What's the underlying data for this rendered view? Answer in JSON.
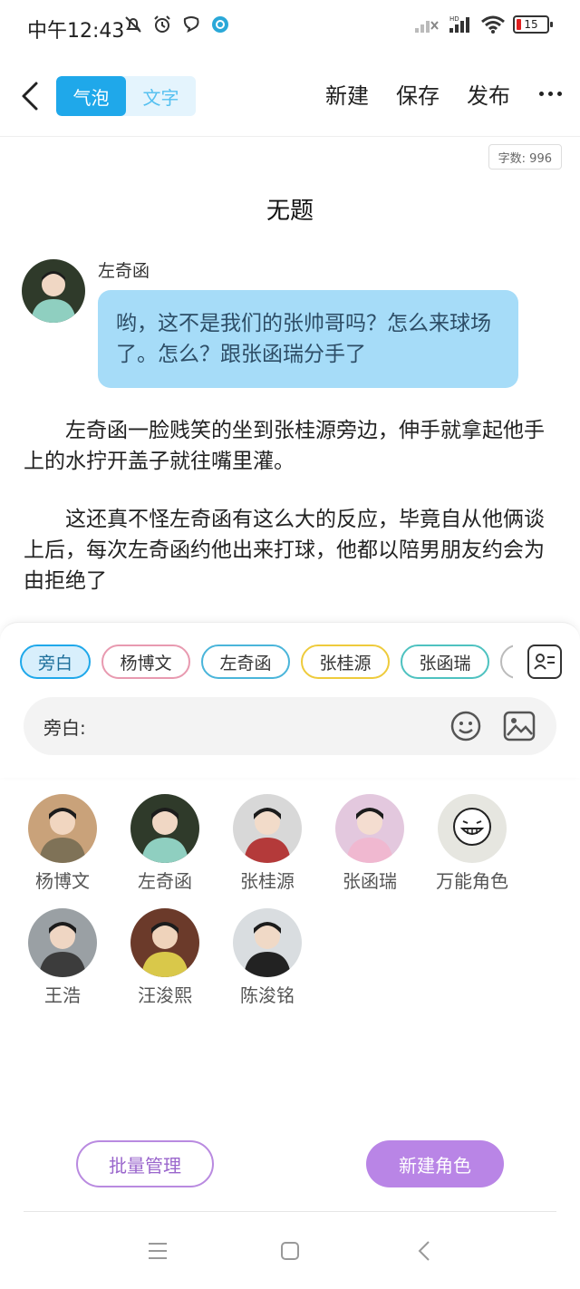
{
  "status_bar": {
    "time": "中午12:43",
    "battery": "15"
  },
  "top_bar": {
    "tab_bubble": "气泡",
    "tab_text": "文字",
    "new": "新建",
    "save": "保存",
    "publish": "发布"
  },
  "word_count": "字数: 996",
  "title": "无题",
  "dialogue": {
    "speaker": "左奇函",
    "text": "哟，这不是我们的张帅哥吗？怎么来球场了。怎么？跟张函瑞分手了"
  },
  "narrations": [
    "左奇函一脸贱笑的坐到张桂源旁边，伸手就拿起他手上的水拧开盖子就往嘴里灌。",
    "这还真不怪左奇函有这么大的反应，毕竟自从他俩谈上后，每次左奇函约他出来打球，他都以陪男朋友约会为由拒绝了"
  ],
  "chips": [
    "旁白",
    "杨博文",
    "左奇函",
    "张桂源",
    "张函瑞"
  ],
  "input": {
    "label": "旁白:"
  },
  "characters": [
    {
      "name": "杨博文",
      "bg": "#c9a27a",
      "skin": "#f1d6c0",
      "shirt": "#7f7257"
    },
    {
      "name": "左奇函",
      "bg": "#2f3a2a",
      "skin": "#f0d7c4",
      "shirt": "#8fcfc0"
    },
    {
      "name": "张桂源",
      "bg": "#d8d8d8",
      "skin": "#f2dbc9",
      "shirt": "#b43a3a"
    },
    {
      "name": "张函瑞",
      "bg": "#e3c8de",
      "skin": "#f4ddd0",
      "shirt": "#f0b8d0"
    },
    {
      "name": "万能角色",
      "bg": "#e6e6e0",
      "skin": "#ffffff",
      "shirt": "#e6e6e0"
    },
    {
      "name": "王浩",
      "bg": "#9aa0a4",
      "skin": "#efd6c3",
      "shirt": "#3c3c3c"
    },
    {
      "name": "汪浚熙",
      "bg": "#6b3a2a",
      "skin": "#efd3bb",
      "shirt": "#d9c84a"
    },
    {
      "name": "陈浚铭",
      "bg": "#d9dde0",
      "skin": "#f0d9c6",
      "shirt": "#222222"
    }
  ],
  "buttons": {
    "batch": "批量管理",
    "new_character": "新建角色"
  }
}
